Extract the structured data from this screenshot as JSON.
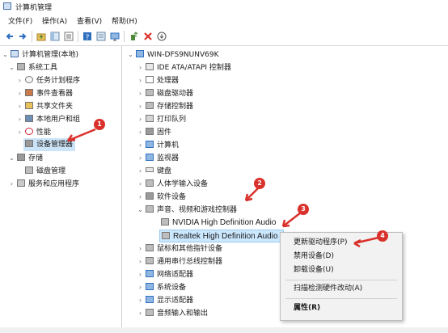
{
  "window": {
    "title": "计算机管理"
  },
  "menu": [
    "文件(F)",
    "操作(A)",
    "查看(V)",
    "帮助(H)"
  ],
  "toolbar_icons": [
    "back-icon",
    "forward-icon",
    "up-folder-icon",
    "show-hide-tree-icon",
    "properties-icon",
    "help-icon",
    "view-icon",
    "monitor-icon",
    "update-driver-icon",
    "uninstall-icon",
    "scan-icon"
  ],
  "left_tree": {
    "root": "计算机管理(本地)",
    "system_tools": "系统工具",
    "task_scheduler": "任务计划程序",
    "event_viewer": "事件查看器",
    "shared_folders": "共享文件夹",
    "local_users": "本地用户和组",
    "performance": "性能",
    "device_manager": "设备管理器",
    "storage": "存储",
    "disk_management": "磁盘管理",
    "services_apps": "服务和应用程序"
  },
  "device_tree": {
    "computer_name": "WIN-DFS9NUNV69K",
    "categories": [
      "IDE ATA/ATAPI 控制器",
      "处理器",
      "磁盘驱动器",
      "存储控制器",
      "打印队列",
      "固件",
      "计算机",
      "监视器",
      "键盘",
      "人体学输入设备",
      "软件设备",
      "声音、视频和游戏控制器"
    ],
    "audio_children": [
      "NVIDIA High Definition Audio",
      "Realtek High Definition Audio"
    ],
    "categories_after": [
      "鼠标和其他指针设备",
      "通用串行总线控制器",
      "网络适配器",
      "系统设备",
      "显示适配器",
      "音频输入和输出"
    ]
  },
  "context_menu": {
    "update_driver": "更新驱动程序(P)",
    "disable_device": "禁用设备(D)",
    "uninstall_device": "卸载设备(U)",
    "scan_hardware": "扫描检测硬件改动(A)",
    "properties": "属性(R)"
  },
  "annotations": [
    "1",
    "2",
    "3",
    "4"
  ],
  "colors": {
    "annotation": "#d9312b",
    "selection": "#cce8ff",
    "icon_blue": "#2f6fbf"
  }
}
